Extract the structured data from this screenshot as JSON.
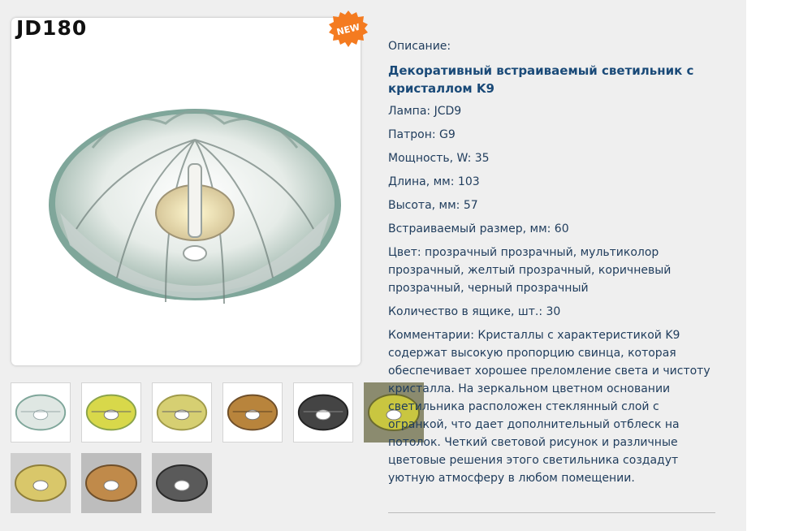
{
  "product": {
    "code": "JD180",
    "badge": "NEW",
    "thumbnails": [
      {
        "color_name": "прозрачный",
        "tint": "#e8efe8"
      },
      {
        "color_name": "мультиколор",
        "tint": "#d8d84a"
      },
      {
        "color_name": "желтый",
        "tint": "#d6cf72"
      },
      {
        "color_name": "коричневый",
        "tint": "#b8843c"
      },
      {
        "color_name": "черный",
        "tint": "#444444"
      },
      {
        "color_name": "мультиколор",
        "tint": "#c9c640"
      },
      {
        "color_name": "желтый",
        "tint": "#d9c76a"
      },
      {
        "color_name": "коричневый",
        "tint": "#c08a4a"
      },
      {
        "color_name": "черный",
        "tint": "#5a5a5a"
      }
    ]
  },
  "details": {
    "section_label": "Описание:",
    "title": "Декоративный встраиваемый светильник с кристаллом K9",
    "lamp": "Лампа: JCD9",
    "socket": "Патрон: G9",
    "power": "Мощность, W: 35",
    "length": "Длина, мм: 103",
    "height": "Высота, мм: 57",
    "cutout": "Встраиваемый размер, мм: 60",
    "color": "Цвет: прозрачный прозрачный, мультиколор прозрачный, желтый прозрачный, коричневый прозрачный, черный прозрачный",
    "box_qty": "Количество в ящике, шт.: 30",
    "comments": "Комментарии: Кристаллы с характеристикой K9 содержат высокую пропорцию свинца, которая обеспечивает хорошее преломление света и чистоту кристалла. На зеркальном цветном основании светильника расположен стеклянный слой с огранкой, что дает дополнительный отблеск на потолок. Четкий световой рисунок и различные цветовые решения этого светильника создадут уютную атмосферу в любом помещении."
  },
  "colors": {
    "panel_bg": "#efefef",
    "text": "#1f3c5c",
    "title": "#1a4a78",
    "badge": "#f47b20"
  }
}
